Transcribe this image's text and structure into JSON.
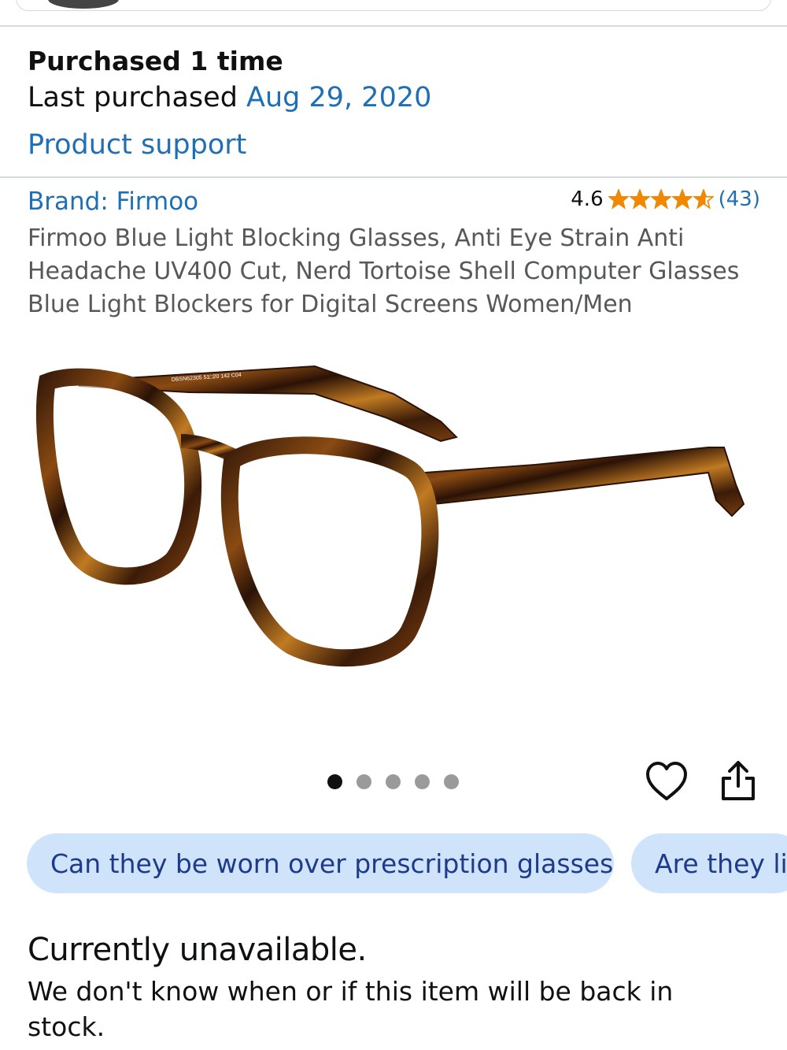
{
  "purchase": {
    "count_label": "Purchased 1 time",
    "last_label": "Last purchased ",
    "last_date": "Aug 29, 2020",
    "support_link": "Product support"
  },
  "product": {
    "brand": "Brand: Firmoo",
    "rating_value": "4.6",
    "stars": 4.6,
    "review_count": "(43)",
    "title": "Firmoo Blue Light Blocking Glasses, Anti Eye Strain Anti Headache UV400 Cut, Nerd Tortoise Shell Computer Glasses Blue Light Blockers for Digital Screens Women/Men",
    "frame_imprint": "DBSN62305 51□20 142 C04"
  },
  "carousel": {
    "total": 5,
    "active": 1
  },
  "icons": {
    "wishlist": "heart-icon",
    "share": "share-icon",
    "star": "star-icon"
  },
  "questions": [
    "Can they be worn over prescription glasses?",
    "Are they lig"
  ],
  "availability": {
    "status": "Currently unavailable.",
    "message": "We don't know when or if this item will be back in stock."
  },
  "colors": {
    "link": "#1f6fb5",
    "star": "#f08804",
    "chip_bg": "#cfe4fb",
    "chip_text": "#1e3a8a"
  }
}
